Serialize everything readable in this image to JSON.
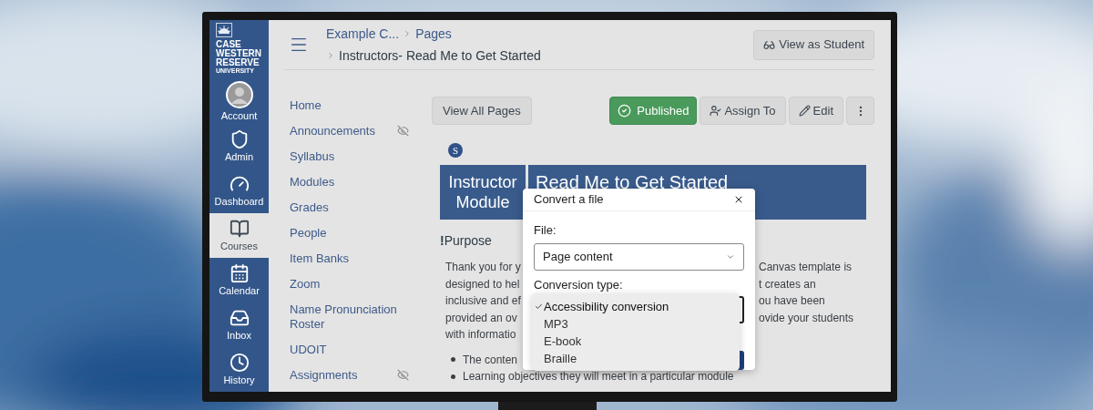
{
  "logo": {
    "lines": [
      "CASE",
      "WESTERN",
      "RESERVE"
    ],
    "subtitle": "UNIVERSITY"
  },
  "global_nav": [
    {
      "label": "Account",
      "kind": "account",
      "selected": false
    },
    {
      "label": "Admin",
      "kind": "admin",
      "selected": false
    },
    {
      "label": "Dashboard",
      "kind": "dashboard",
      "selected": false
    },
    {
      "label": "Courses",
      "kind": "courses",
      "selected": true
    },
    {
      "label": "Calendar",
      "kind": "calendar",
      "selected": false
    },
    {
      "label": "Inbox",
      "kind": "inbox",
      "selected": false
    },
    {
      "label": "History",
      "kind": "history",
      "selected": false
    }
  ],
  "breadcrumbs": {
    "course": "Example C...",
    "section": "Pages",
    "page": "Instructors- Read Me to Get Started"
  },
  "view_as_student": "View as Student",
  "course_nav": [
    {
      "label": "Home",
      "hidden": false
    },
    {
      "label": "Announcements",
      "hidden": true
    },
    {
      "label": "Syllabus",
      "hidden": false
    },
    {
      "label": "Modules",
      "hidden": false
    },
    {
      "label": "Grades",
      "hidden": false
    },
    {
      "label": "People",
      "hidden": false
    },
    {
      "label": "Item Banks",
      "hidden": false
    },
    {
      "label": "Zoom",
      "hidden": false
    },
    {
      "label": "Name Pronunciation Roster",
      "hidden": false
    },
    {
      "label": "UDOIT",
      "hidden": false
    },
    {
      "label": "Assignments",
      "hidden": true
    }
  ],
  "toolbar": {
    "view_all": "View All Pages",
    "published": true,
    "published_label": "Published",
    "assign": "Assign To",
    "edit": "Edit"
  },
  "badge": "S",
  "banner": {
    "left": [
      "Instructor",
      "Module"
    ],
    "right": "Read Me to Get Started"
  },
  "heading": "**!**Purpose",
  "paragraph_lines": [
    {
      "left": "Thank you for y",
      "right": "Canvas template is"
    },
    {
      "left": "designed to hel",
      "right": "t creates an"
    },
    {
      "left": "inclusive and ef",
      "right": "ou have been"
    },
    {
      "left": "provided an ov",
      "right": "ovide your students"
    },
    {
      "left": "with informatio"
    }
  ],
  "bullets": [
    "The conten",
    "Learning objectives they will meet in a particular module"
  ],
  "dialog": {
    "title": "Convert a file",
    "file_label": "File:",
    "file_value": "Page content",
    "type_label": "Conversion type:",
    "options": [
      {
        "label": "Accessibility conversion",
        "selected": true
      },
      {
        "label": "MP3",
        "selected": false
      },
      {
        "label": "E-book",
        "selected": false
      },
      {
        "label": "Braille",
        "selected": false
      }
    ]
  }
}
